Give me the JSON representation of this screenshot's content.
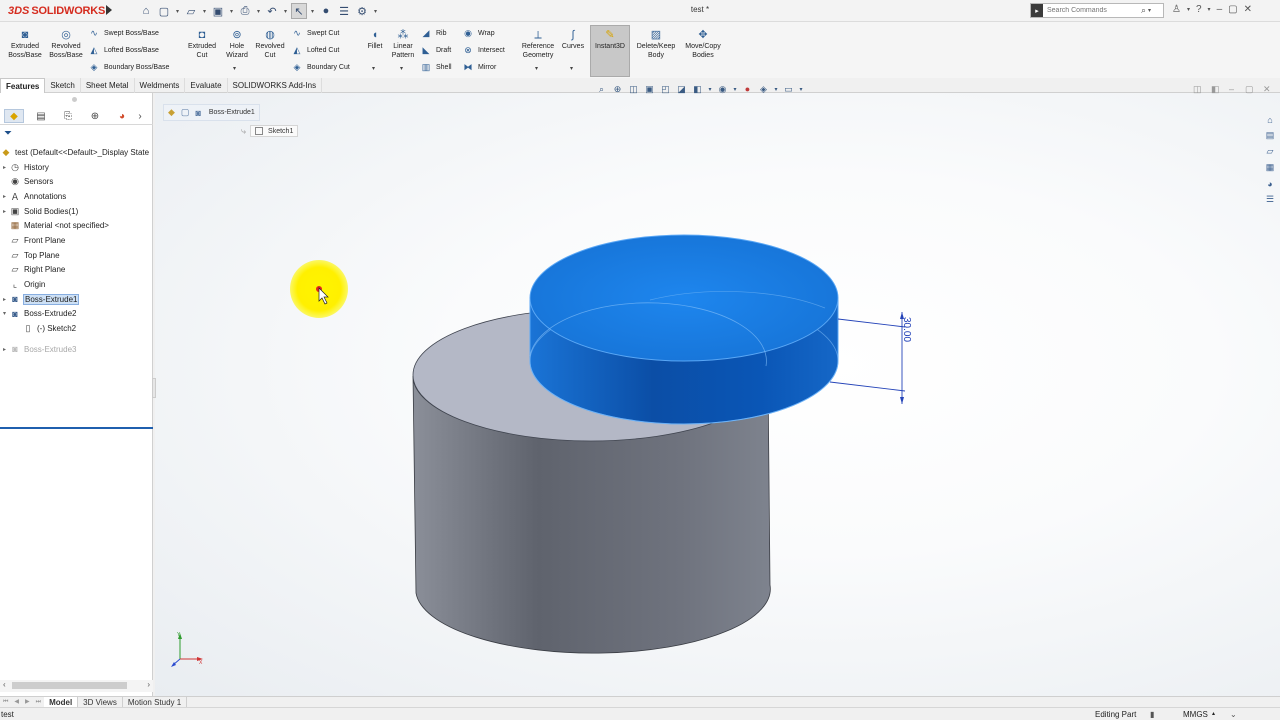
{
  "app": {
    "logo_prefix": "3DS",
    "logo_text": "SOLIDWORKS",
    "document_title": "test *",
    "search_placeholder": "Search Commands"
  },
  "command_manager": {
    "big_buttons": [
      {
        "label": "Extruded Boss/Base",
        "icon": "extruded-boss-icon"
      },
      {
        "label": "Revolved Boss/Base",
        "icon": "revolved-boss-icon"
      },
      {
        "label": "Extruded Cut",
        "icon": "extruded-cut-icon"
      },
      {
        "label": "Hole Wizard",
        "icon": "hole-wizard-icon"
      },
      {
        "label": "Revolved Cut",
        "icon": "revolved-cut-icon"
      },
      {
        "label": "Fillet",
        "icon": "fillet-icon"
      },
      {
        "label": "Linear Pattern",
        "icon": "linear-pattern-icon"
      },
      {
        "label": "Reference Geometry",
        "icon": "reference-geometry-icon"
      },
      {
        "label": "Curves",
        "icon": "curves-icon"
      },
      {
        "label": "Instant3D",
        "icon": "instant3d-icon"
      },
      {
        "label": "Delete/Keep Body",
        "icon": "delete-keep-body-icon"
      },
      {
        "label": "Move/Copy Bodies",
        "icon": "move-copy-bodies-icon"
      }
    ],
    "small_buttons": [
      {
        "label": "Swept Boss/Base"
      },
      {
        "label": "Lofted Boss/Base"
      },
      {
        "label": "Boundary Boss/Base"
      },
      {
        "label": "Swept Cut"
      },
      {
        "label": "Lofted Cut"
      },
      {
        "label": "Boundary Cut"
      },
      {
        "label": "Rib"
      },
      {
        "label": "Draft"
      },
      {
        "label": "Shell"
      },
      {
        "label": "Wrap"
      },
      {
        "label": "Intersect"
      },
      {
        "label": "Mirror"
      }
    ]
  },
  "tabs": [
    "Features",
    "Sketch",
    "Sheet Metal",
    "Weldments",
    "Evaluate",
    "SOLIDWORKS Add-Ins"
  ],
  "feature_tree": {
    "root": "test  (Default<<Default>_Display State",
    "items": [
      {
        "label": "History",
        "expandable": true
      },
      {
        "label": "Sensors",
        "expandable": false
      },
      {
        "label": "Annotations",
        "expandable": true
      },
      {
        "label": "Solid Bodies(1)",
        "expandable": true
      },
      {
        "label": "Material <not specified>",
        "expandable": false
      },
      {
        "label": "Front Plane",
        "expandable": false
      },
      {
        "label": "Top Plane",
        "expandable": false
      },
      {
        "label": "Right Plane",
        "expandable": false
      },
      {
        "label": "Origin",
        "expandable": false
      },
      {
        "label": "Boss-Extrude1",
        "expandable": true
      },
      {
        "label": "Boss-Extrude2",
        "expandable": true
      },
      {
        "label": "(-) Sketch2",
        "expandable": false
      },
      {
        "label": "Boss-Extrude3",
        "expandable": true
      }
    ]
  },
  "breadcrumb": {
    "feature": "Boss-Extrude1",
    "sketch": "Sketch1"
  },
  "dimension": {
    "value": "30.00"
  },
  "bottom_tabs": [
    "Model",
    "3D Views",
    "Motion Study 1"
  ],
  "status": {
    "left": "test",
    "mode": "Editing Part",
    "units": "MMGS"
  },
  "colors": {
    "selected_body": "#1a78d8",
    "base_body": "#7c818d",
    "accent": "#1f5fae"
  }
}
